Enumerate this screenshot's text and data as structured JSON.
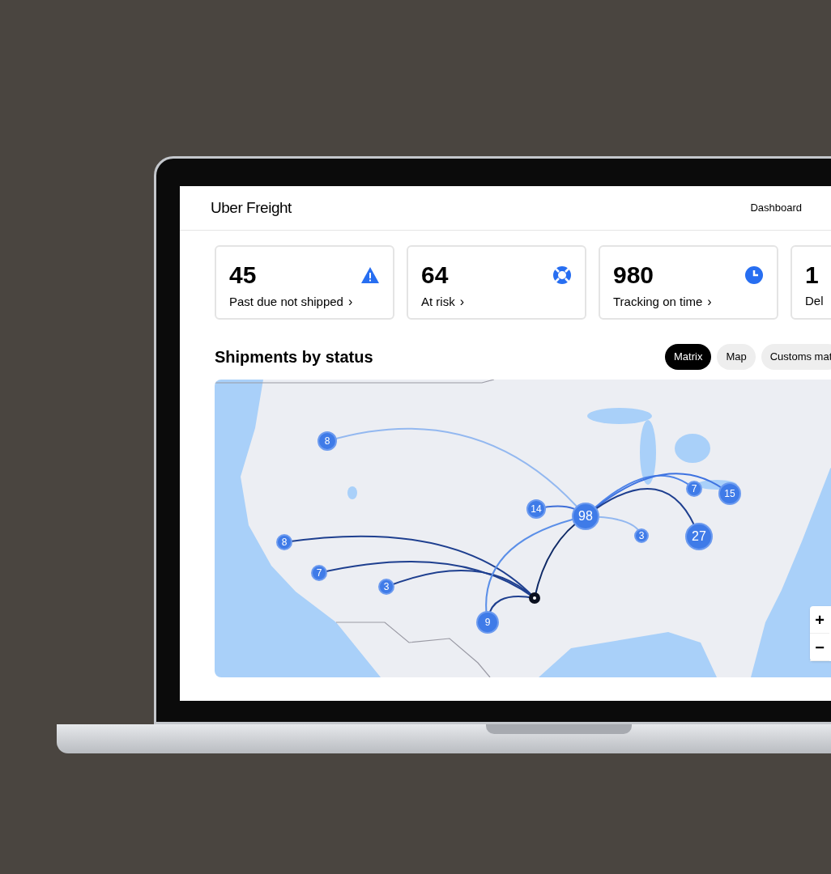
{
  "header": {
    "logo": "Uber Freight",
    "nav": [
      {
        "label": "Dashboard"
      }
    ]
  },
  "cards": [
    {
      "kind": "warning",
      "value": "45",
      "label": "Past due not shipped",
      "chevron": "›"
    },
    {
      "kind": "lifebuoy",
      "value": "64",
      "label": "At risk",
      "chevron": "›"
    },
    {
      "kind": "clock",
      "value": "980",
      "label": "Tracking on time",
      "chevron": "›"
    },
    {
      "kind": "none",
      "value": "1",
      "label": "Del"
    }
  ],
  "section": {
    "title": "Shipments by status",
    "tabs": [
      {
        "label": "Matrix",
        "selected": true
      },
      {
        "label": "Map",
        "selected": false
      },
      {
        "label": "Customs mat",
        "selected": false
      }
    ]
  },
  "map": {
    "clusters": [
      {
        "count": "8"
      },
      {
        "count": "7"
      },
      {
        "count": "15"
      },
      {
        "count": "14"
      },
      {
        "count": "98"
      },
      {
        "count": "8"
      },
      {
        "count": "3"
      },
      {
        "count": "27"
      },
      {
        "count": "7"
      },
      {
        "count": "3"
      },
      {
        "count": "9"
      }
    ],
    "zoom": [
      "+",
      "−"
    ]
  }
}
